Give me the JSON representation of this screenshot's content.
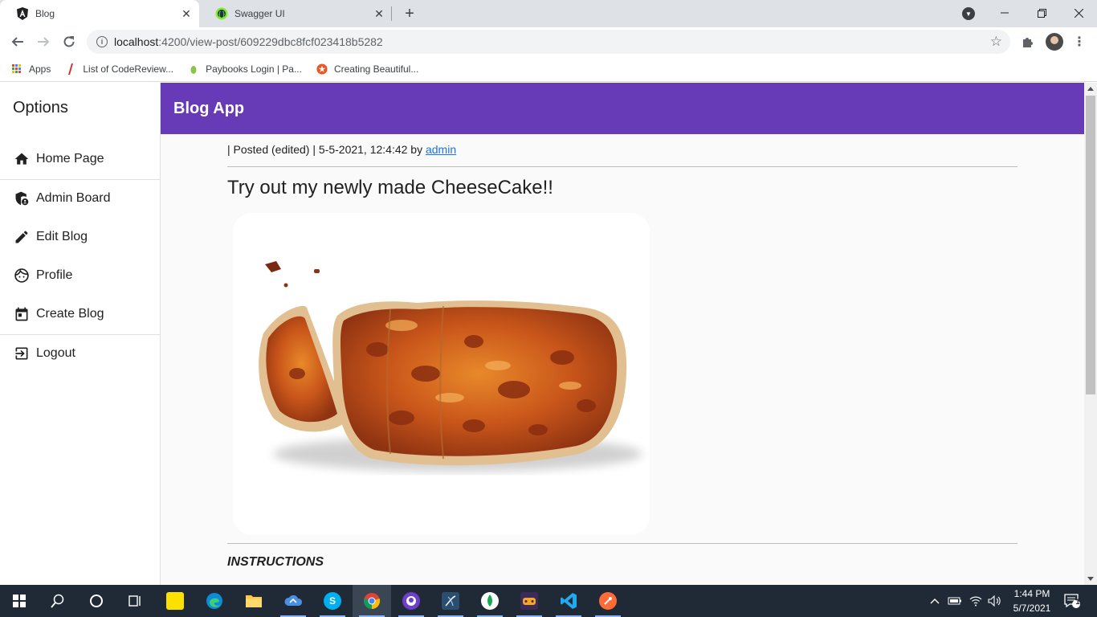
{
  "browser": {
    "tabs": [
      {
        "title": "Blog",
        "active": true,
        "favicon": "angular-icon"
      },
      {
        "title": "Swagger UI",
        "active": false,
        "favicon": "swagger-icon"
      }
    ],
    "url_host": "localhost",
    "url_rest": ":4200/view-post/609229dbc8fcf023418b5282",
    "bookmarks": [
      {
        "label": "Apps",
        "icon": "apps-grid-icon"
      },
      {
        "label": "List of CodeReview...",
        "icon": "codereview-icon"
      },
      {
        "label": "Paybooks Login | Pa...",
        "icon": "paybooks-icon"
      },
      {
        "label": "Creating Beautiful...",
        "icon": "star-badge-icon"
      }
    ]
  },
  "sidebar": {
    "title": "Options",
    "items": [
      {
        "label": "Home Page",
        "icon": "home-icon"
      },
      {
        "label": "Admin Board",
        "icon": "admin-shield-icon"
      },
      {
        "label": "Edit Blog",
        "icon": "pencil-icon"
      },
      {
        "label": "Profile",
        "icon": "face-icon"
      },
      {
        "label": "Create Blog",
        "icon": "calendar-icon"
      },
      {
        "label": "Logout",
        "icon": "logout-icon"
      }
    ]
  },
  "appbar": {
    "title": "Blog App"
  },
  "post": {
    "meta_prefix": "| Posted (edited) | 5-5-2021, 12:4:42 by ",
    "author": "admin",
    "title": "Try out my newly made CheeseCake!!",
    "section_heading": "INSTRUCTIONS"
  },
  "taskbar": {
    "time": "1:44 PM",
    "date": "5/7/2021",
    "notification_count": "1"
  },
  "colors": {
    "appbar": "#673ab7",
    "link": "#1a73e8",
    "taskbar": "#1f2a36"
  }
}
